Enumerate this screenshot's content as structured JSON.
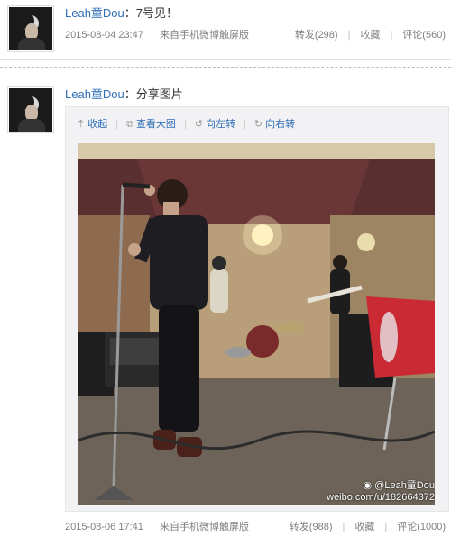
{
  "posts": [
    {
      "username": "Leah童Dou",
      "colon": "：",
      "text": "7号见！",
      "time": "2015-08-04 23:47",
      "source": "来自手机微博触屏版",
      "repost": "转发(298)",
      "favorite": "收藏",
      "comment": "评论(560)"
    },
    {
      "username": "Leah童Dou",
      "colon": "：",
      "text": "分享图片",
      "toolbar": {
        "collapse": "收起",
        "view_large": "查看大图",
        "rotate_left": "向左转",
        "rotate_right": "向右转"
      },
      "watermark_handle": "@Leah童Dou",
      "watermark_url": "weibo.com/u/182664372",
      "time": "2015-08-06 17:41",
      "source": "来自手机微博触屏版",
      "repost": "转发(988)",
      "favorite": "收藏",
      "comment": "评论(1000)"
    }
  ],
  "icons": {
    "collapse": "arrow-up-icon",
    "view_large": "external-link-icon",
    "rotate_left": "rotate-left-icon",
    "rotate_right": "rotate-right-icon",
    "weibo": "weibo-logo-icon"
  },
  "colors": {
    "link": "#2f6fb6",
    "meta": "#808080"
  }
}
